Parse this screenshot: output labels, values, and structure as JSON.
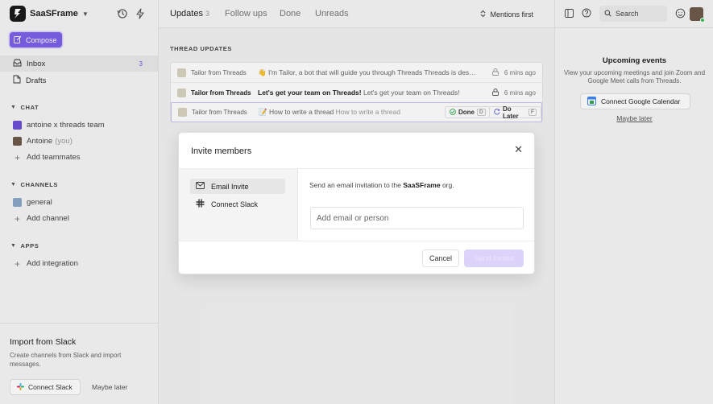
{
  "workspace": {
    "name": "SaaSFrame"
  },
  "sidebar": {
    "compose_label": "Compose",
    "nav": [
      {
        "label": "Inbox",
        "count": "3"
      },
      {
        "label": "Drafts"
      }
    ],
    "chat": {
      "title": "CHAT",
      "items": [
        {
          "label": "antoine x threads team"
        },
        {
          "label": "Antoine",
          "suffix": "(you)"
        }
      ],
      "add_label": "Add teammates"
    },
    "channels": {
      "title": "CHANNELS",
      "items": [
        {
          "label": "general"
        }
      ],
      "add_label": "Add channel"
    },
    "apps": {
      "title": "APPS",
      "add_label": "Add integration"
    },
    "import": {
      "title": "Import from Slack",
      "description": "Create channels from Slack and import messages.",
      "connect_label": "Connect Slack",
      "maybe_label": "Maybe later"
    }
  },
  "main": {
    "tabs": [
      {
        "label": "Updates",
        "count": "3"
      },
      {
        "label": "Follow ups"
      },
      {
        "label": "Done"
      },
      {
        "label": "Unreads"
      }
    ],
    "sort_label": "Mentions first",
    "section_title": "THREAD UPDATES",
    "threads": [
      {
        "from": "Tailor from Threads",
        "emoji": "👋",
        "subject": "",
        "preview": "I'm Tailor, a bot that will guide you through Threads Threads is desig...",
        "time": "6 mins ago"
      },
      {
        "from": "Tailor from Threads",
        "emoji": "",
        "subject": "Let's get your team on Threads!",
        "preview": "Let's get your team on Threads!",
        "time": "6 mins ago"
      },
      {
        "from": "Tailor from Threads",
        "emoji": "📝",
        "subject": "How to write a thread",
        "preview": "How to write a thread",
        "done_label": "Done",
        "done_key": "D",
        "later_label": "Do Later",
        "later_key": "F"
      }
    ]
  },
  "right": {
    "search_label": "Search",
    "upcoming_title": "Upcoming events",
    "upcoming_desc": "View your upcoming meetings and join Zoom and Google Meet calls from Threads.",
    "gcal_label": "Connect Google Calendar",
    "maybe_label": "Maybe later"
  },
  "modal": {
    "title": "Invite members",
    "options": [
      {
        "label": "Email Invite"
      },
      {
        "label": "Connect Slack"
      }
    ],
    "message_prefix": "Send an email invitation to the",
    "message_org": "SaaSFrame",
    "message_suffix": "org.",
    "input_placeholder": "Add email or person",
    "cancel_label": "Cancel",
    "send_label": "Send invites"
  },
  "colors": {
    "accent": "#7b61e8",
    "accent_disabled": "#dcd3fb",
    "online": "#3cbf5a"
  },
  "icons": [
    "logo-icon",
    "history-icon",
    "bolt-icon",
    "compose-icon",
    "inbox-icon",
    "drafts-icon",
    "plus-icon",
    "lock-icon",
    "sort-icon",
    "panel-icon",
    "help-icon",
    "search-icon",
    "emoji-icon",
    "close-icon",
    "mail-icon",
    "slack-icon",
    "calendar-icon"
  ]
}
